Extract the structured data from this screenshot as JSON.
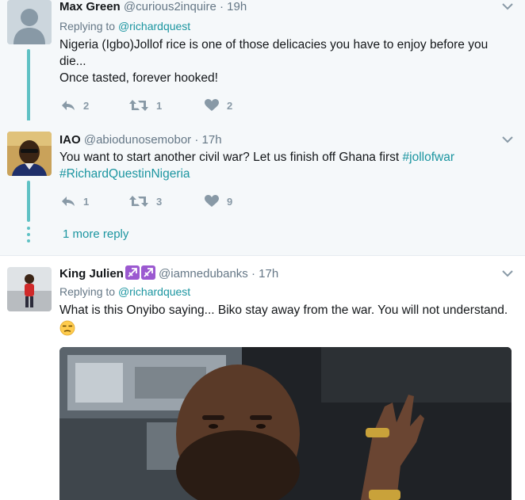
{
  "tweets": [
    {
      "name": "Max Green",
      "handle": "@curious2inquire",
      "sep": "·",
      "time": "19h",
      "replying_prefix": "Replying to",
      "replying_to": "@richardquest",
      "text_line1": "Nigeria (Igbo)Jollof rice is one of those delicacies you have to enjoy before you",
      "text_line2": "die...",
      "text_line3": "Once tasted, forever hooked!",
      "replies": "2",
      "retweets": "1",
      "likes": "2"
    },
    {
      "name": "IAO",
      "handle": "@abiodunosemobor",
      "sep": "·",
      "time": "17h",
      "text_plain": "You want to start another civil war? Let us finish off Ghana first ",
      "hashtag1": "#jollofwar",
      "hashtag2": "#RichardQuestinNigeria",
      "replies": "1",
      "retweets": "3",
      "likes": "9"
    },
    {
      "name": "King Julien",
      "handle": "@iamnedubanks",
      "sep": "·",
      "time": "17h",
      "replying_prefix": "Replying to",
      "replying_to": "@richardquest",
      "text": "What is this Onyibo saying... Biko stay away from the war.  You will not understand."
    }
  ],
  "more_reply": "1 more reply",
  "icons": {
    "reply": "reply-icon",
    "retweet": "retweet-icon",
    "like": "heart-icon",
    "caret": "chevron-down-icon",
    "badge": "sagittarius-icon",
    "emoji": "unamused-face-emoji"
  },
  "colors": {
    "link": "#1b95a0",
    "thread": "#5fc1c4",
    "muted": "#657786",
    "highlight_bg": "#f5f8fa"
  }
}
